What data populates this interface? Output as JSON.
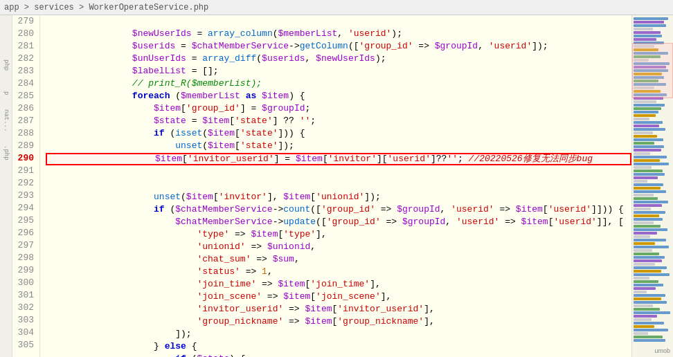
{
  "breadcrumb": {
    "text": "app > services > WorkerOperateService.php"
  },
  "lines": [
    {
      "num": 279,
      "indent": 2,
      "code": "$newUserIds = array_column($memberList, 'userid');"
    },
    {
      "num": 280,
      "indent": 2,
      "code": "$userids = $chatMemberService->getColumn(['group_id' => $groupId, 'userid']);"
    },
    {
      "num": 281,
      "indent": 2,
      "code": "$unUserIds = array_diff($userids, $newUserIds);"
    },
    {
      "num": 282,
      "indent": 2,
      "code": "$labelList = [];"
    },
    {
      "num": 283,
      "indent": 2,
      "code": "// print_R($memberList);"
    },
    {
      "num": 284,
      "indent": 2,
      "code": "foreach ($memberList as $item) {"
    },
    {
      "num": 285,
      "indent": 3,
      "code": "$item['group_id'] = $groupId;"
    },
    {
      "num": 286,
      "indent": 3,
      "code": "$state = $item['state'] ?? '';"
    },
    {
      "num": 287,
      "indent": 3,
      "code": "if (isset($item['state'])) {"
    },
    {
      "num": 288,
      "indent": 4,
      "code": "unset($item['state']);"
    },
    {
      "num": 289,
      "indent": 3,
      "code": "}"
    },
    {
      "num": 290,
      "indent": 3,
      "code": "$item['invitor_userid'] = $item['invitor']['userid']??''; //20220526修复无法同步bug",
      "boxed": true
    },
    {
      "num": 291,
      "indent": 3,
      "code": ""
    },
    {
      "num": 292,
      "indent": 3,
      "code": "unset($item['invitor'], $item['unionid']);"
    },
    {
      "num": 293,
      "indent": 3,
      "code": "if ($chatMemberService->count(['group_id' => $groupId, 'userid' => $item['userid']])) {"
    },
    {
      "num": 294,
      "indent": 4,
      "code": "$chatMemberService->update(['group_id' => $groupId, 'userid' => $item['userid']], ["
    },
    {
      "num": 295,
      "indent": 5,
      "code": "'type' => $item['type'],"
    },
    {
      "num": 296,
      "indent": 5,
      "code": "'unionid' => $unionid,"
    },
    {
      "num": 297,
      "indent": 5,
      "code": "'chat_sum' => $sum,"
    },
    {
      "num": 298,
      "indent": 5,
      "code": "'status' => 1,"
    },
    {
      "num": 299,
      "indent": 5,
      "code": "'join_time' => $item['join_time'],"
    },
    {
      "num": 300,
      "indent": 5,
      "code": "'join_scene' => $item['join_scene'],"
    },
    {
      "num": 301,
      "indent": 5,
      "code": "'invitor_userid' => $item['invitor_userid'],"
    },
    {
      "num": 302,
      "indent": 5,
      "code": "'group_nickname' => $item['group_nickname'],"
    },
    {
      "num": 303,
      "indent": 4,
      "code": "]);"
    },
    {
      "num": 304,
      "indent": 3,
      "code": "} else {"
    },
    {
      "num": 305,
      "indent": 4,
      "code": "if ($state) {"
    }
  ],
  "sidebar_labels": {
    "php": "php",
    "p": "p",
    "nat": "nat...",
    "phpfile": ".php"
  },
  "bottom_label": "umob",
  "type_label": "type"
}
